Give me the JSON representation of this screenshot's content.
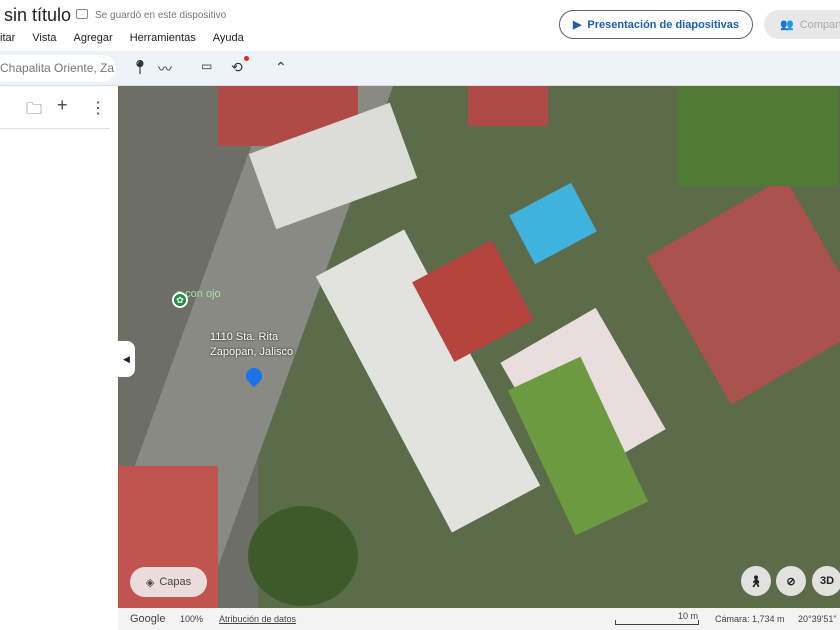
{
  "header": {
    "title": "sin título",
    "save_status": "Se guardó en este dispositivo",
    "slideshow_label": "Presentación de diapositivas",
    "share_label": "Compartir"
  },
  "menu": [
    "itar",
    "Vista",
    "Agregar",
    "Herramientas",
    "Ayuda"
  ],
  "search": {
    "value": "Chapalita Oriente, Za"
  },
  "map": {
    "place_label": "o con ojo",
    "address_line1": "1110 Sta. Rita",
    "address_line2": "Zapopan, Jalisco",
    "layers_label": "Capas",
    "threed_label": "3D"
  },
  "footer": {
    "brand": "Google",
    "zoom": "100%",
    "attribution": "Atribución de datos",
    "scale": "10 m",
    "camera": "Cámara: 1,734 m",
    "coords": "20°39'51\""
  }
}
